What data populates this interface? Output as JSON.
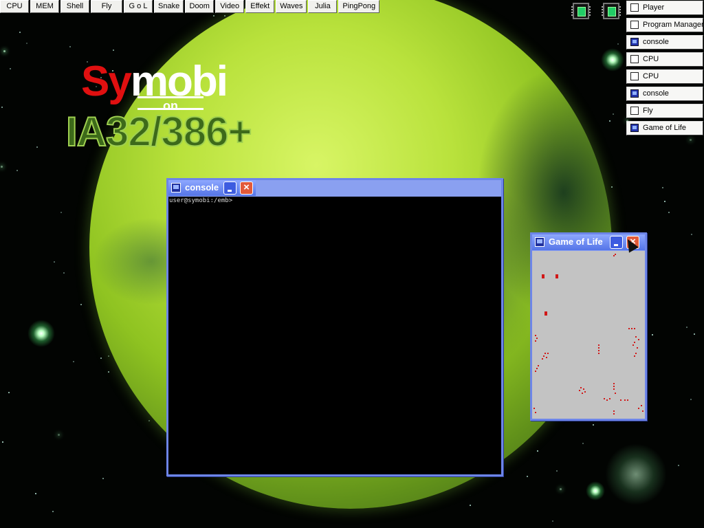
{
  "taskbar": {
    "buttons": [
      "CPU",
      "MEM",
      "Shell",
      "Fly",
      "G o L",
      "Snake",
      "Doom",
      "Video",
      "Effekt",
      "Waves",
      "Julia",
      "PingPong"
    ]
  },
  "window_list": {
    "items": [
      "Player",
      "Program Manager",
      "console",
      "CPU",
      "CPU",
      "console",
      "Fly",
      "Game of Life"
    ]
  },
  "logo": {
    "sy": "Sy",
    "mobi": "mobi",
    "on": "on",
    "platform": "IA32/386+"
  },
  "console_window": {
    "title": "console",
    "minimize": "_",
    "close": "×",
    "text": "user@symobi:/emb>"
  },
  "gol_window": {
    "title": "Game of Life",
    "minimize": "_",
    "close": "×"
  },
  "colors": {
    "titlebar": "#5474e8",
    "window_border": "#6d85e8",
    "logo_red": "#e01010",
    "logo_green": "#3d6a1a",
    "cell": "#d01818"
  },
  "icons": {
    "chip_1": "cpu-chip-icon",
    "chip_2": "cpu-chip-icon",
    "window_icon": "terminal-icon"
  }
}
